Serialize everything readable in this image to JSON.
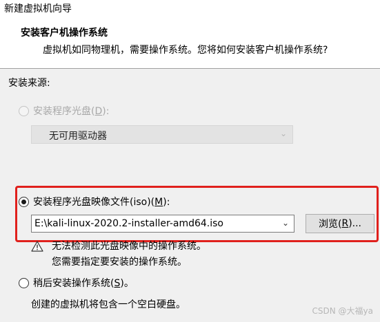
{
  "window": {
    "title": "新建虚拟机向导"
  },
  "header": {
    "title": "安装客户机操作系统",
    "subtitle": "虚拟机如同物理机，需要操作系统。您将如何安装客户机操作系统?"
  },
  "install_source_label": "安装来源:",
  "options": {
    "disc": {
      "label_prefix": "安装程序光盘(",
      "label_key": "D",
      "label_suffix": "):",
      "selected": false,
      "enabled": false,
      "drive_value": "无可用驱动器"
    },
    "iso": {
      "label_prefix": "安装程序光盘映像文件(iso)(",
      "label_key": "M",
      "label_suffix": "):",
      "selected": true,
      "path_value": "E:\\kali-linux-2020.2-installer-amd64.iso",
      "browse_prefix": "浏览(",
      "browse_key": "R",
      "browse_suffix": ")...",
      "warning_line1": "无法检测此光盘映像中的操作系统。",
      "warning_line2": "您需要指定要安装的操作系统。"
    },
    "later": {
      "label_prefix": "稍后安装操作系统(",
      "label_key": "S",
      "label_suffix": ")。",
      "selected": false,
      "description": "创建的虚拟机将包含一个空白硬盘。"
    }
  },
  "watermark": "CSDN @大福ya",
  "colors": {
    "highlight": "#e0201c",
    "disabled_text": "#a8a8a8"
  },
  "icons": {
    "warning": "warning-triangle-icon",
    "dropdown": "chevron-down-icon"
  }
}
